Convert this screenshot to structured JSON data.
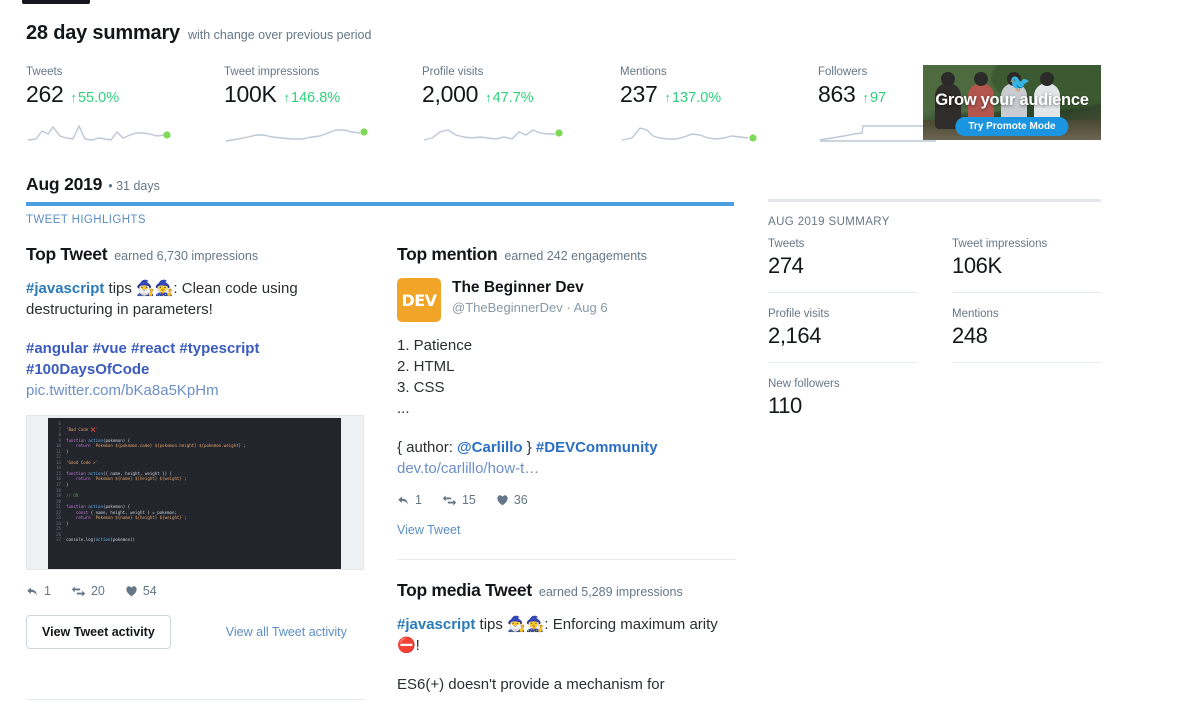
{
  "summary": {
    "title": "28 day summary",
    "subtitle": "with change over previous period",
    "metrics": [
      {
        "label": "Tweets",
        "value": "262",
        "delta": "55.0%",
        "arrow": "↑"
      },
      {
        "label": "Tweet impressions",
        "value": "100K",
        "delta": "146.8%",
        "arrow": "↑"
      },
      {
        "label": "Profile visits",
        "value": "2,000",
        "delta": "47.7%",
        "arrow": "↑"
      },
      {
        "label": "Mentions",
        "value": "237",
        "delta": "137.0%",
        "arrow": "↑"
      },
      {
        "label": "Followers",
        "value": "863",
        "delta": "97",
        "arrow": "↑"
      }
    ]
  },
  "promote": {
    "title": "Grow your audience",
    "button": "Try Promote Mode",
    "bird_icon": "twitter-bird-icon"
  },
  "month": {
    "title": "Aug 2019",
    "days": "• 31 days",
    "tab": "TWEET HIGHLIGHTS",
    "summary_caption": "AUG 2019 SUMMARY"
  },
  "top_tweet": {
    "title": "Top Tweet",
    "meta": "earned 6,730 impressions",
    "line1_tag": "#javascript",
    "line1_rest": " tips 🧙‍♂️🧙‍♀️: Clean code using destructuring in parameters!",
    "hashtags_1": "#angular #vue #react #typescript",
    "hashtags_2": "#100DaysOfCode",
    "pic_link": "pic.twitter.com/bKa8a5KpHm",
    "replies": "1",
    "retweets": "20",
    "likes": "54",
    "button": "View Tweet activity",
    "link": "View all Tweet activity",
    "code": [
      {
        "n": "6",
        "t": ""
      },
      {
        "n": "7",
        "t": "'Bad Code ❌'"
      },
      {
        "n": "8",
        "t": ""
      },
      {
        "n": "9",
        "t": "function action(pokemon) {"
      },
      {
        "n": "10",
        "t": "    return `Pokemon ${pokemon.name} ${pokemon.height} ${pokemon.weight}`;"
      },
      {
        "n": "11",
        "t": "}"
      },
      {
        "n": "12",
        "t": ""
      },
      {
        "n": "13",
        "t": "'Good Code ✔'"
      },
      {
        "n": "14",
        "t": ""
      },
      {
        "n": "15",
        "t": "function action({ name, height, weight }) {"
      },
      {
        "n": "16",
        "t": "    return `Pokemon ${name} ${height} ${weight}`;"
      },
      {
        "n": "17",
        "t": "}"
      },
      {
        "n": "18",
        "t": ""
      },
      {
        "n": "19",
        "t": "// OR"
      },
      {
        "n": "20",
        "t": ""
      },
      {
        "n": "21",
        "t": "function action(pokemon) {"
      },
      {
        "n": "22",
        "t": "    const { name, height, weight } = pokemon;"
      },
      {
        "n": "23",
        "t": "    return `Pokemon ${name} ${height} ${weight}`;"
      },
      {
        "n": "24",
        "t": "}"
      },
      {
        "n": "25",
        "t": ""
      },
      {
        "n": "26",
        "t": ""
      },
      {
        "n": "27",
        "t": "console.log(action(pokemon))"
      }
    ]
  },
  "top_mention": {
    "title": "Top mention",
    "meta": "earned 242 engagements",
    "avatar_text": "DEV",
    "user_name": "The Beginner Dev",
    "user_handle": "@TheBeginnerDev · Aug 6",
    "body_1": "1. Patience",
    "body_2": "2. HTML",
    "body_3": "3. CSS",
    "body_4": "...",
    "author_prefix": "{ author: ",
    "author_handle": "@Carlillo",
    "author_suffix": " } ",
    "community_tag": "#DEVCommunity",
    "link": "dev.to/carlillo/how-t…",
    "replies": "1",
    "retweets": "15",
    "likes": "36",
    "view": "View Tweet"
  },
  "top_media_tweet": {
    "title": "Top media Tweet",
    "meta": "earned 5,289 impressions",
    "line1_tag": "#javascript",
    "line1_rest": " tips 🧙‍♂️🧙‍♀️: Enforcing maximum arity ⛔!",
    "line2": "ES6(+) doesn't provide a mechanism for"
  },
  "month_summary": {
    "stats": [
      {
        "label": "Tweets",
        "value": "274"
      },
      {
        "label": "Tweet impressions",
        "value": "106K"
      },
      {
        "label": "Profile visits",
        "value": "2,164"
      },
      {
        "label": "Mentions",
        "value": "248"
      },
      {
        "label": "New followers",
        "value": "110"
      }
    ]
  },
  "colors": {
    "accent_blue": "#4a9fe0",
    "link_blue": "#5b8ec4",
    "positive_green": "#2fd07b",
    "hashtag_purple": "#3b5bbd",
    "dev_orange": "#f0a529"
  }
}
